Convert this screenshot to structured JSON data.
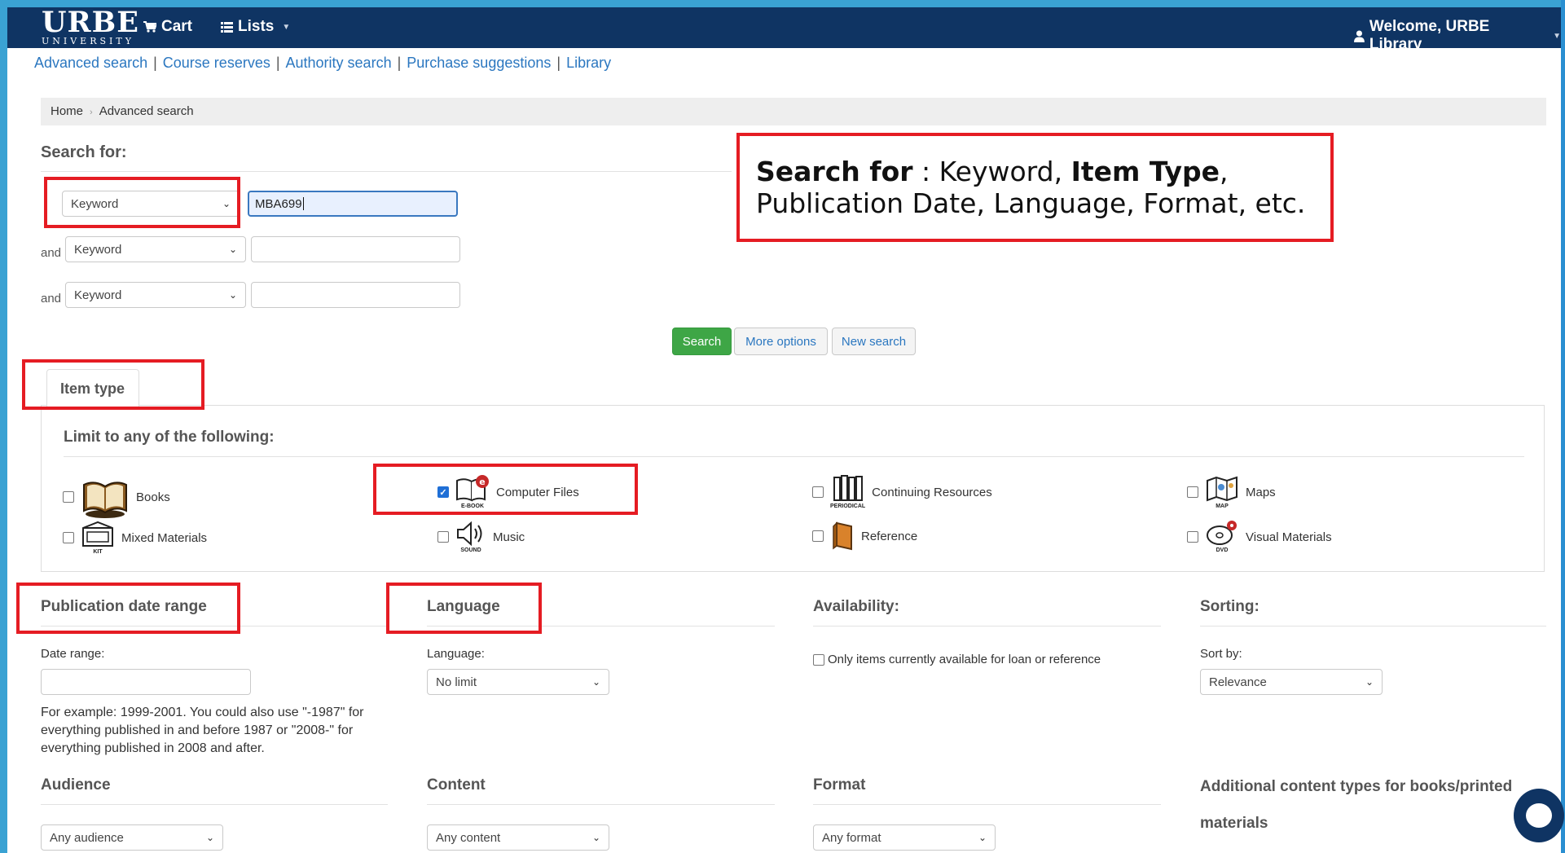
{
  "navbar": {
    "logo_main": "URBE",
    "logo_sub": "UNIVERSITY",
    "cart_label": "Cart",
    "lists_label": "Lists",
    "welcome_label": "Welcome, URBE Library"
  },
  "toplinks": [
    "Advanced search",
    "Course reserves",
    "Authority search",
    "Purchase suggestions",
    "Library"
  ],
  "breadcrumb": {
    "home": "Home",
    "current": "Advanced search"
  },
  "search": {
    "heading": "Search for:",
    "and_label": "and",
    "rows": [
      {
        "field": "Keyword",
        "value": "MBA699"
      },
      {
        "field": "Keyword",
        "value": ""
      },
      {
        "field": "Keyword",
        "value": ""
      }
    ],
    "buttons": {
      "search": "Search",
      "more": "More options",
      "new": "New search"
    }
  },
  "callout": {
    "bold1": "Search for",
    "text1": " : Keyword, ",
    "bold2": "Item Type",
    "text2": ", Publication Date, Language, Format, etc."
  },
  "item_type": {
    "tab_label": "Item type",
    "limit_heading": "Limit to any of the following:",
    "items": [
      {
        "label": "Books",
        "icon": "book-icon",
        "caption": "",
        "checked": false
      },
      {
        "label": "Mixed Materials",
        "icon": "kit-icon",
        "caption": "KIT",
        "checked": false
      },
      {
        "label": "Computer Files",
        "icon": "ebook-icon",
        "caption": "E-BOOK",
        "checked": true
      },
      {
        "label": "Music",
        "icon": "sound-icon",
        "caption": "SOUND",
        "checked": false
      },
      {
        "label": "Continuing Resources",
        "icon": "periodical-icon",
        "caption": "PERIODICAL",
        "checked": false
      },
      {
        "label": "Reference",
        "icon": "reference-icon",
        "caption": "",
        "checked": false
      },
      {
        "label": "Maps",
        "icon": "map-icon",
        "caption": "MAP",
        "checked": false
      },
      {
        "label": "Visual Materials",
        "icon": "dvd-icon",
        "caption": "DVD",
        "checked": false
      }
    ]
  },
  "pubdate": {
    "heading": "Publication date range",
    "label": "Date range:",
    "help": "For example: 1999-2001. You could also use \"-1987\" for everything published in and before 1987 or \"2008-\" for everything published in 2008 and after."
  },
  "language": {
    "heading": "Language",
    "label": "Language:",
    "value": "No limit"
  },
  "availability": {
    "heading": "Availability:",
    "option": "Only items currently available for loan or reference"
  },
  "sorting": {
    "heading": "Sorting:",
    "label": "Sort by:",
    "value": "Relevance"
  },
  "audience": {
    "heading": "Audience",
    "value": "Any audience"
  },
  "content": {
    "heading": "Content",
    "value": "Any content"
  },
  "format": {
    "heading": "Format",
    "value": "Any format"
  },
  "additional": {
    "heading": "Additional content types for books/printed materials"
  },
  "colors": {
    "navbar": "#0f3463",
    "link": "#2b77c0",
    "search_button": "#3ea646",
    "highlight": "#e51c23",
    "frame": "#3aa2d3"
  }
}
